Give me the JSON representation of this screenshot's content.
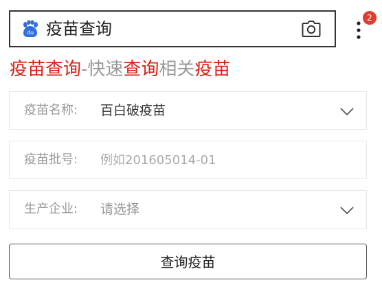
{
  "search": {
    "query": "疫苗查询",
    "logo_icon": "baidu-paw-icon",
    "camera_icon": "camera-icon",
    "more_icon": "vertical-dots-icon",
    "badge_count": "2"
  },
  "headline": {
    "parts": [
      "疫苗查询",
      "-快速",
      "查询",
      "相关",
      "疫苗"
    ]
  },
  "form": {
    "name_label": "疫苗名称:",
    "name_value": "百白破疫苗",
    "batch_label": "疫苗批号:",
    "batch_placeholder": "例如201605014-01",
    "company_label": "生产企业:",
    "company_value": "请选择"
  },
  "submit_label": "查询疫苗",
  "colors": {
    "accent_red": "#d91f11",
    "baidu_blue": "#2f6fe0",
    "badge_red": "#e33b2e",
    "muted_gray": "#999999"
  }
}
